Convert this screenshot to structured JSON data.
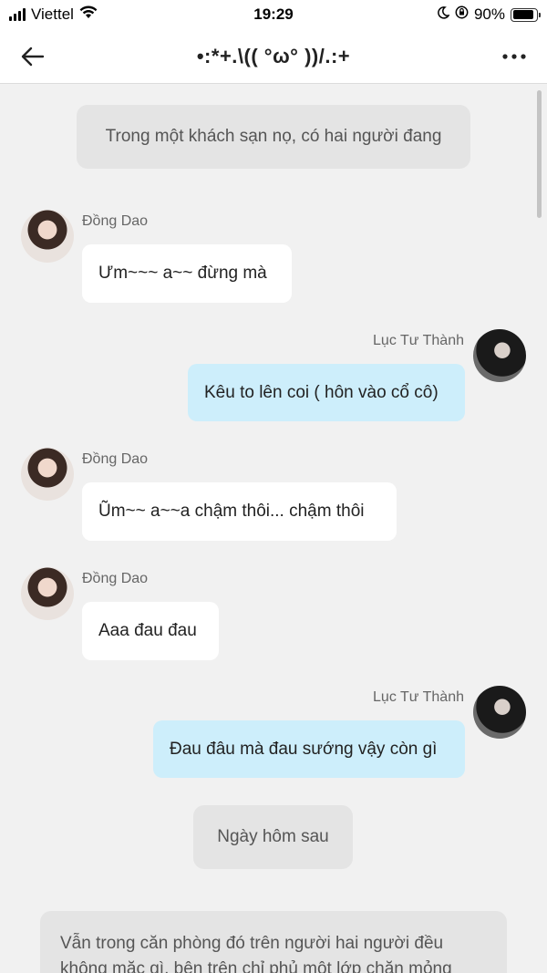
{
  "status_bar": {
    "carrier": "Viettel",
    "time": "19:29",
    "battery_percent": "90%",
    "battery_level": 0.9
  },
  "header": {
    "title": "•:*+.\\(( °ω° ))/.:+"
  },
  "messages": [
    {
      "type": "narration",
      "text": "Trong một khách sạn nọ, có hai người đang"
    },
    {
      "type": "incoming",
      "sender": "Đồng Dao",
      "text": "Ưm~~~ a~~ đừng mà"
    },
    {
      "type": "outgoing",
      "sender": "Lục Tư Thành",
      "text": "Kêu to lên coi ( hôn vào cổ cô)"
    },
    {
      "type": "incoming",
      "sender": "Đồng Dao",
      "text": "Ũm~~ a~~a chậm thôi... chậm thôi"
    },
    {
      "type": "incoming",
      "sender": "Đồng Dao",
      "text": "Aaa đau đau"
    },
    {
      "type": "outgoing",
      "sender": "Lục Tư Thành",
      "text": "Đau đâu mà đau sướng vậy còn gì"
    },
    {
      "type": "narration",
      "text": "Ngày hôm sau"
    },
    {
      "type": "narration",
      "text": "Vẫn trong căn phòng đó trên người hai người đều không mặc gì, bên trên chỉ phủ một lớp chăn mỏng"
    }
  ]
}
